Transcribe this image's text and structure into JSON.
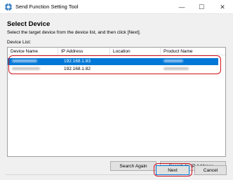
{
  "window": {
    "title": "Send Function Setting Tool",
    "controls": {
      "minimize": "—",
      "maximize": "☐",
      "close": "✕"
    },
    "icon": "printer-gear-icon"
  },
  "page": {
    "heading": "Select Device",
    "instruction": "Select the target device from the device list, and then click [Next].",
    "list_label": "Device List:"
  },
  "device_list": {
    "columns": [
      "Device Name",
      "IP Address",
      "Location",
      "Product Name"
    ],
    "rows": [
      {
        "ip": "192.168.1.83",
        "selected": true
      },
      {
        "ip": "192.168.1.82",
        "selected": false
      }
    ]
  },
  "buttons": {
    "search_again": "Search Again",
    "search_by_ip": "Search by IP Address...",
    "next": "Next",
    "cancel": "Cancel"
  },
  "colors": {
    "selection": "#0078d7",
    "highlight": "#d0111b",
    "background": "#f0f0f0"
  }
}
